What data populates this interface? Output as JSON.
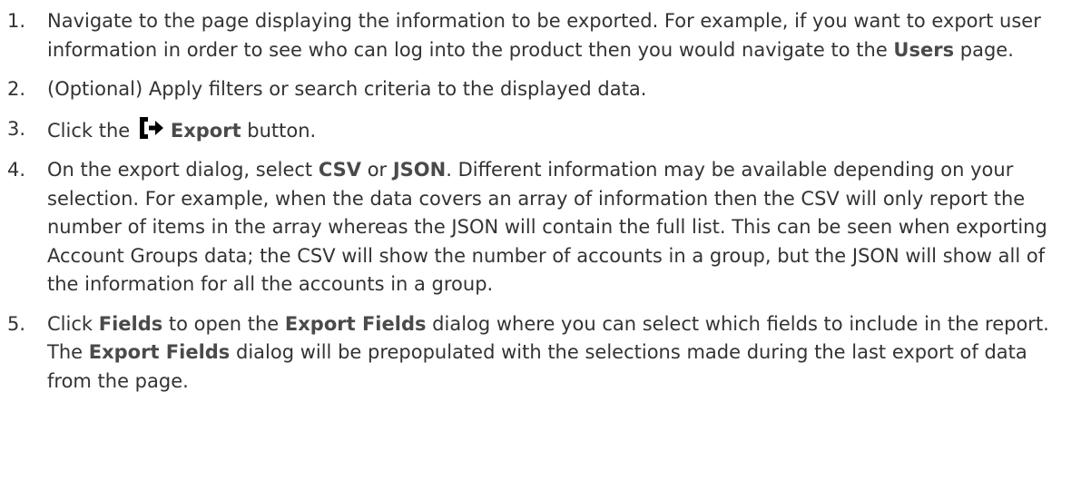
{
  "steps": [
    {
      "number": "1.",
      "parts": [
        "Navigate to the page displaying the information to be exported. For example, if you want to export user information in order to see who can log into the product then you would navigate to the ",
        "Users",
        " page."
      ]
    },
    {
      "number": "2.",
      "parts": [
        "(Optional) Apply filters or search criteria to the displayed data."
      ]
    },
    {
      "number": "3.",
      "icon": "export-icon",
      "parts": [
        "Click the ",
        "Export",
        " button."
      ]
    },
    {
      "number": "4.",
      "parts": [
        "On the export dialog, select ",
        "CSV",
        " or ",
        "JSON",
        ". Different information may be available depending on your selection. For example, when the data covers an array of information then the CSV will only report the number of items in the array whereas the JSON will contain the full list. This can be seen when exporting Account Groups data; the CSV will show the number of accounts in a group, but the JSON will show all of the information for all the accounts in a group."
      ]
    },
    {
      "number": "5.",
      "parts": [
        "Click ",
        "Fields",
        " to open the ",
        "Export Fields",
        " dialog where you can select which fields to include in the report. The ",
        "Export Fields",
        " dialog will be prepopulated with the selections made during the last export of data from the page."
      ]
    }
  ]
}
